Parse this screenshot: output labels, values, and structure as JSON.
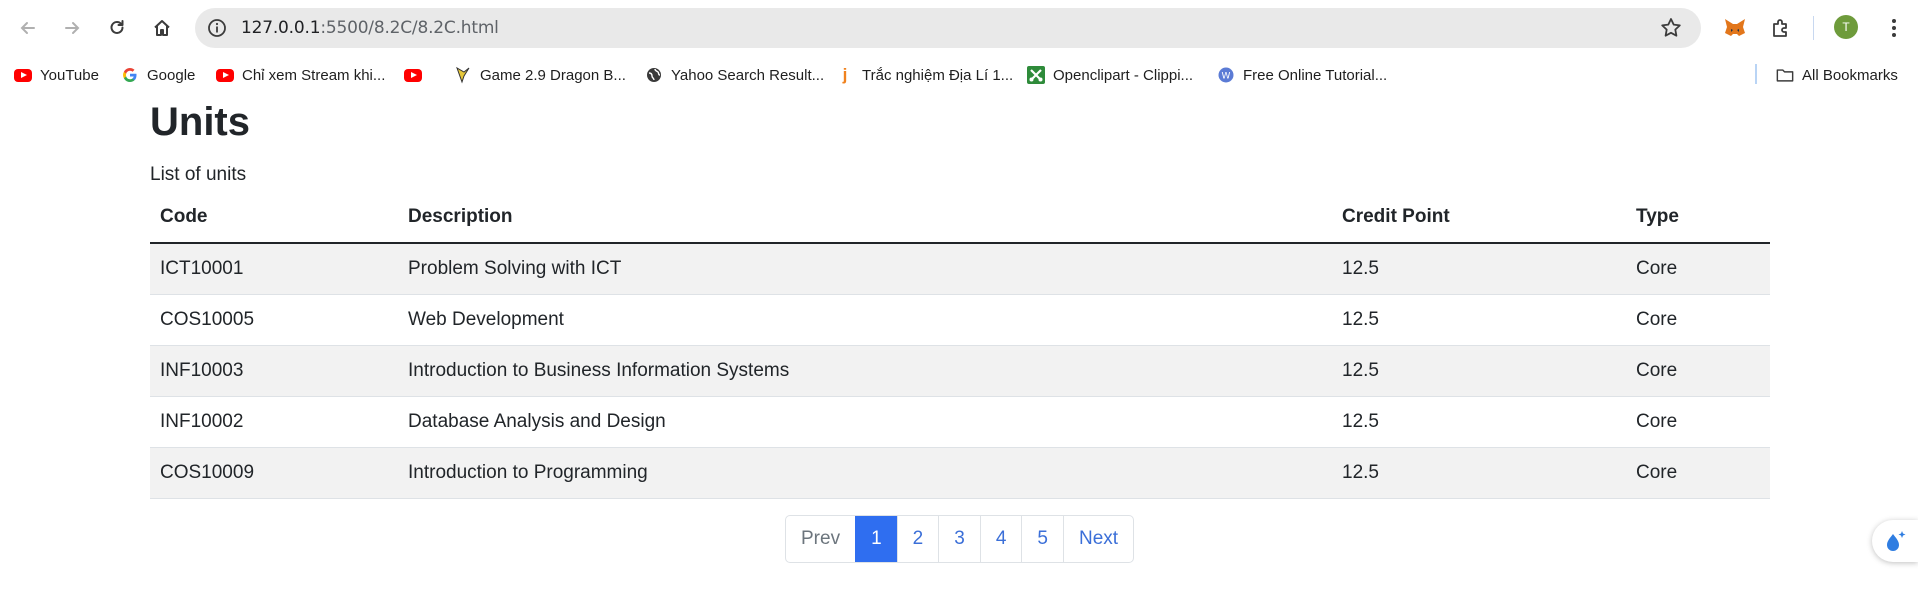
{
  "browser": {
    "url_host": "127.0.0.1",
    "url_path": ":5500/8.2C/8.2C.html",
    "avatar_letter": "T"
  },
  "bookmarks": [
    {
      "label": "YouTube",
      "icon": "youtube-icon"
    },
    {
      "label": "Google",
      "icon": "google-icon"
    },
    {
      "label": "Chỉ xem Stream khi...",
      "icon": "youtube-icon"
    },
    {
      "label": "",
      "icon": "youtube-icon"
    },
    {
      "label": "Game 2.9 Dragon B...",
      "icon": "dragon-icon"
    },
    {
      "label": "Yahoo Search Result...",
      "icon": "globe-icon"
    },
    {
      "label": "Trắc nghiệm Địa Lí 1...",
      "icon": "j-icon"
    },
    {
      "label": "Openclipart - Clippi...",
      "icon": "openclipart-icon"
    },
    {
      "label": "Free Online Tutorial...",
      "icon": "w-icon"
    }
  ],
  "all_bookmarks_label": "All Bookmarks",
  "page": {
    "title": "Units",
    "subtitle": "List of units"
  },
  "table": {
    "headers": [
      "Code",
      "Description",
      "Credit Point",
      "Type"
    ],
    "rows": [
      [
        "ICT10001",
        "Problem Solving with ICT",
        "12.5",
        "Core"
      ],
      [
        "COS10005",
        "Web Development",
        "12.5",
        "Core"
      ],
      [
        "INF10003",
        "Introduction to Business Information Systems",
        "12.5",
        "Core"
      ],
      [
        "INF10002",
        "Database Analysis and Design",
        "12.5",
        "Core"
      ],
      [
        "COS10009",
        "Introduction to Programming",
        "12.5",
        "Core"
      ]
    ]
  },
  "pagination": {
    "prev": "Prev",
    "pages": [
      "1",
      "2",
      "3",
      "4",
      "5"
    ],
    "active_page": "1",
    "next": "Next"
  },
  "colors": {
    "accent": "#2f6ef0",
    "link": "#3b6fd8",
    "stripe": "#f2f2f2"
  }
}
